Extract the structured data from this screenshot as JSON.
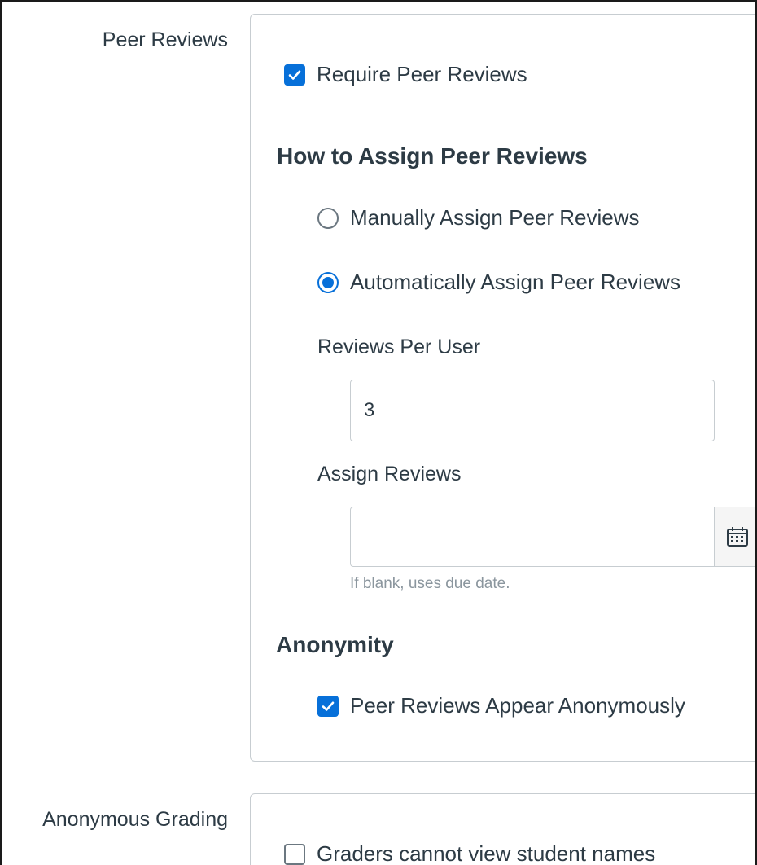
{
  "peer_reviews": {
    "row_label": "Peer Reviews",
    "require_checkbox": {
      "label": "Require Peer Reviews",
      "checked": true
    },
    "assign_heading": "How to Assign Peer Reviews",
    "manual_radio": {
      "label": "Manually Assign Peer Reviews",
      "selected": false
    },
    "auto_radio": {
      "label": "Automatically Assign Peer Reviews",
      "selected": true
    },
    "reviews_per_user": {
      "label": "Reviews Per User",
      "value": "3"
    },
    "assign_reviews": {
      "label": "Assign Reviews",
      "value": "",
      "hint": "If blank, uses due date.",
      "button_icon": "calendar-icon"
    },
    "anonymity_heading": "Anonymity",
    "anonymous_checkbox": {
      "label": "Peer Reviews Appear Anonymously",
      "checked": true
    }
  },
  "anonymous_grading": {
    "row_label": "Anonymous Grading",
    "graders_checkbox": {
      "label": "Graders cannot view student names",
      "checked": false
    }
  },
  "colors": {
    "accent": "#0770d9",
    "text": "#2d3b45",
    "border": "#c7cdd1",
    "hint": "#8b969e"
  }
}
